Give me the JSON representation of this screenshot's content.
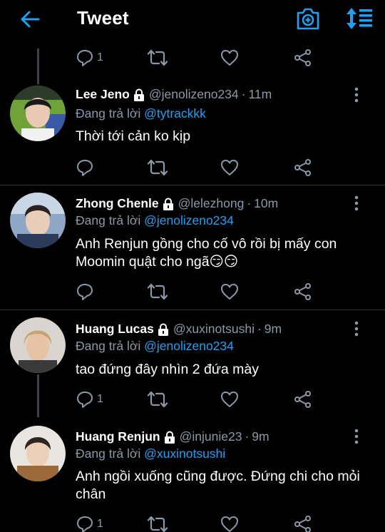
{
  "header": {
    "title": "Tweet"
  },
  "colors": {
    "accent": "#1da1f2",
    "muted": "#8b98a5",
    "background": "#000000"
  },
  "top_actions": {
    "reply_count": "1"
  },
  "tweets": [
    {
      "name": "Lee Jeno",
      "handle": "@jenolizeno234",
      "time": "11m",
      "reply_prefix": "Đang trả lời ",
      "reply_to": "@tytrackkk",
      "text": "Thời tới cản ko kịp",
      "reply_count": ""
    },
    {
      "name": "Zhong Chenle",
      "handle": "@lelezhong",
      "time": "10m",
      "reply_prefix": "Đang trả lời ",
      "reply_to": "@jenolizeno234",
      "text": "Anh Renjun gồng cho cố vô rồi bị mấy con Moomin quật cho ngã😏😏",
      "reply_count": ""
    },
    {
      "name": "Huang Lucas",
      "handle": "@xuxinotsushi",
      "time": "9m",
      "reply_prefix": "Đang trả lời ",
      "reply_to": "@jenolizeno234",
      "text": "tao đứng đây nhìn 2 đứa mày",
      "reply_count": "1"
    },
    {
      "name": "Huang Renjun",
      "handle": "@injunie23",
      "time": "9m",
      "reply_prefix": "Đang trả lời ",
      "reply_to": "@xuxinotsushi",
      "text": "Anh ngồi xuống cũng được. Đứng chi cho mỏi chân",
      "reply_count": "1"
    }
  ]
}
